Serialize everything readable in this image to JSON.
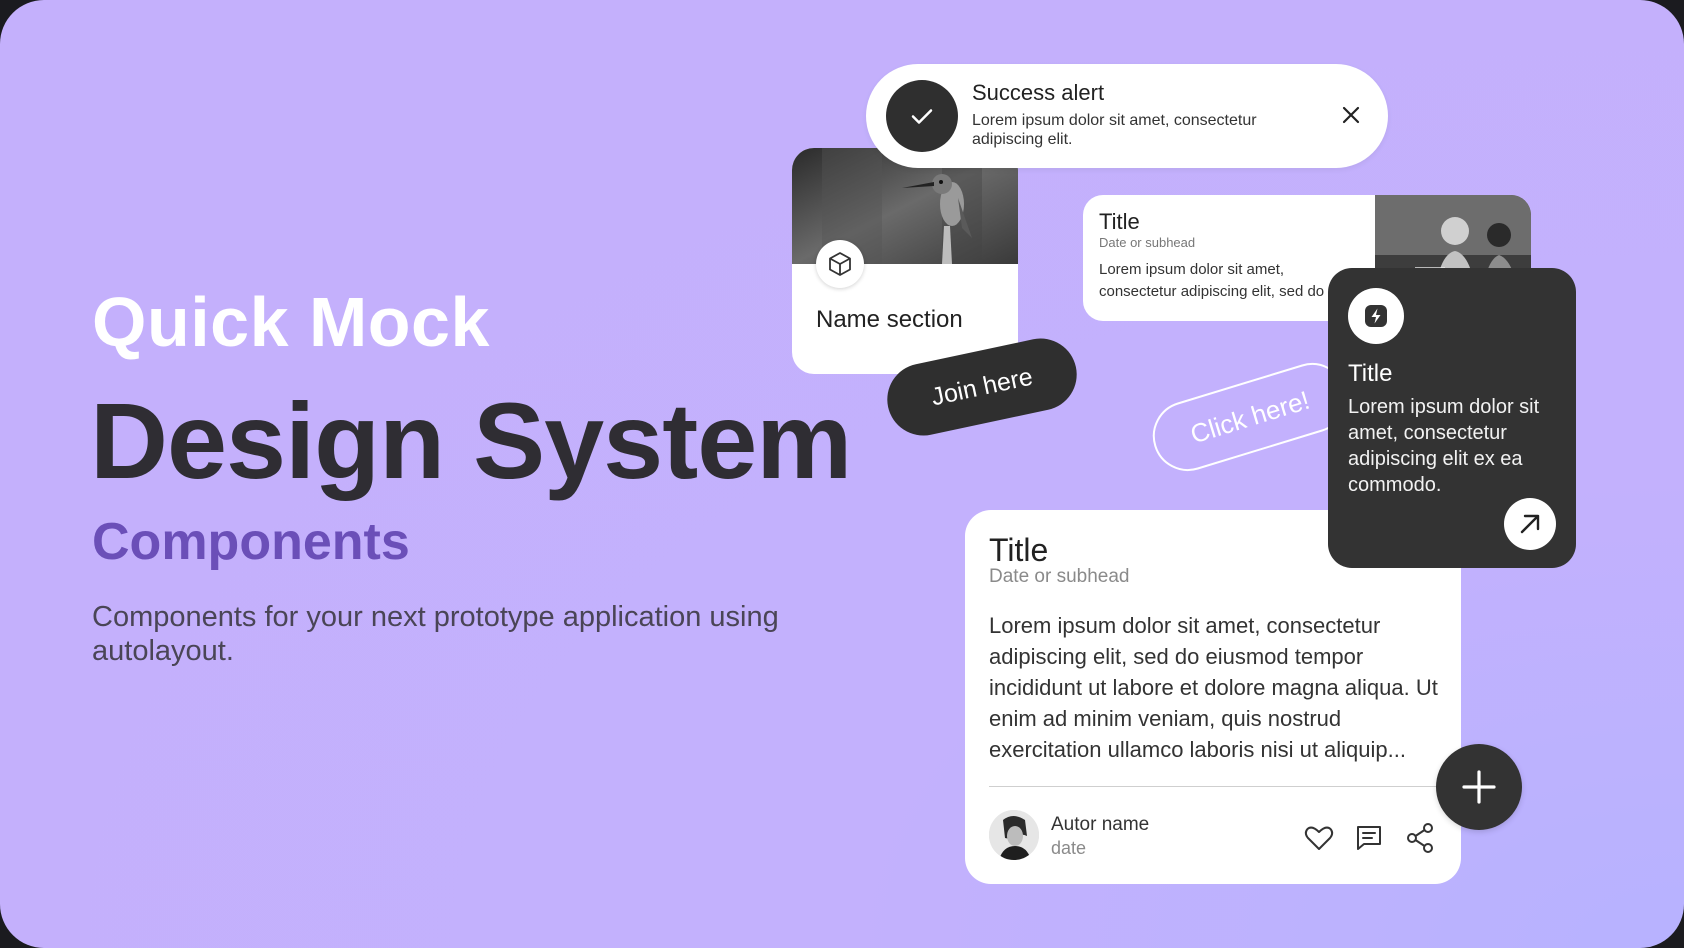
{
  "hero": {
    "eyebrow": "Quick Mock",
    "title": "Design System",
    "subtitle": "Components",
    "description": "Components for your next prototype application using autolayout."
  },
  "alert": {
    "title": "Success alert",
    "text": "Lorem ipsum dolor sit amet, consectetur adipiscing elit.",
    "icon": "check-icon",
    "close_icon": "close-icon"
  },
  "image_card": {
    "label": "Name section",
    "icon": "cube-icon"
  },
  "join_button": {
    "label": "Join here"
  },
  "click_button": {
    "label": "Click here!"
  },
  "small_card": {
    "title": "Title",
    "subhead": "Date or subhead",
    "body": "Lorem ipsum dolor sit amet, consectetur adipiscing elit, sed do"
  },
  "dark_card": {
    "title": "Title",
    "body": "Lorem ipsum dolor sit amet, consectetur adipiscing elit ex ea commodo.",
    "icon": "bolt-icon",
    "action_icon": "arrow-up-right-icon"
  },
  "big_card": {
    "title": "Title",
    "subhead": "Date or subhead",
    "body": "Lorem ipsum dolor sit amet, consectetur adipiscing elit, sed do eiusmod tempor incididunt ut labore et dolore magna aliqua. Ut enim ad minim veniam, quis nostrud exercitation ullamco laboris nisi ut aliquip...",
    "author": {
      "name": "Autor name",
      "date": "date"
    },
    "actions": [
      "heart-icon",
      "comment-icon",
      "share-icon"
    ]
  },
  "fab": {
    "icon": "plus-icon"
  },
  "colors": {
    "background": "#c4b0fc",
    "accent_purple": "#6b4fb8",
    "dark": "#333333",
    "white": "#ffffff"
  }
}
